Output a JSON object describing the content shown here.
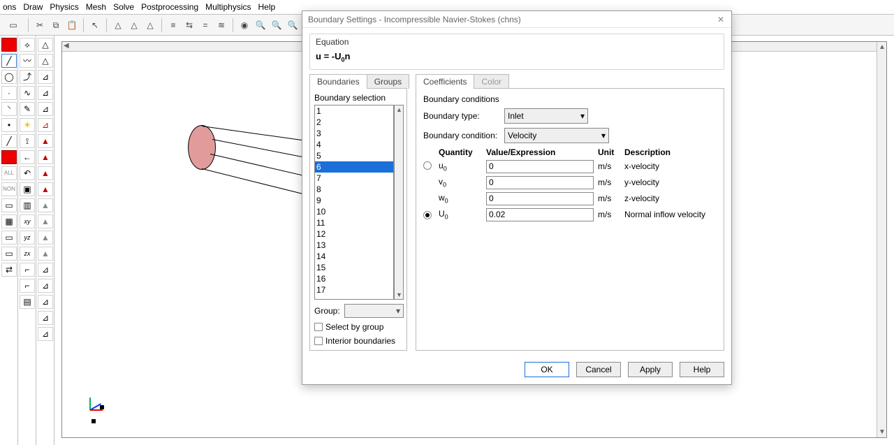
{
  "menu": {
    "items": [
      "ons",
      "Draw",
      "Physics",
      "Mesh",
      "Solve",
      "Postprocessing",
      "Multiphysics",
      "Help"
    ]
  },
  "dialog": {
    "title": "Boundary Settings - Incompressible Navier-Stokes (chns)",
    "equation_label": "Equation",
    "equation_formula_html": "<b>u</b> = -U<sub>0</sub><b>n</b>",
    "tabs_left": {
      "a": "Boundaries",
      "b": "Groups"
    },
    "tabs_right": {
      "a": "Coefficients",
      "b": "Color"
    },
    "boundary_selection_label": "Boundary selection",
    "boundaries": [
      "1",
      "2",
      "3",
      "4",
      "5",
      "6",
      "7",
      "8",
      "9",
      "10",
      "11",
      "12",
      "13",
      "14",
      "15",
      "16",
      "17"
    ],
    "boundary_selected_index": 5,
    "group_label": "Group:",
    "group_value": "",
    "select_by_group": "Select by group",
    "interior_boundaries": "Interior boundaries",
    "bc_header": "Boundary conditions",
    "bt_label": "Boundary type:",
    "bt_value": "Inlet",
    "bcnd_label": "Boundary condition:",
    "bcnd_value": "Velocity",
    "col_qty": "Quantity",
    "col_val": "Value/Expression",
    "col_unit": "Unit",
    "col_desc": "Description",
    "rows": [
      {
        "radio": false,
        "radio_on": false,
        "qty_html": "u<sub>0</sub>",
        "val": "0",
        "unit": "m/s",
        "desc": "x-velocity"
      },
      {
        "radio": null,
        "radio_on": false,
        "qty_html": "v<sub>0</sub>",
        "val": "0",
        "unit": "m/s",
        "desc": "y-velocity"
      },
      {
        "radio": null,
        "radio_on": false,
        "qty_html": "w<sub>0</sub>",
        "val": "0",
        "unit": "m/s",
        "desc": "z-velocity"
      },
      {
        "radio": true,
        "radio_on": true,
        "qty_html": "U<sub>0</sub>",
        "val": "0.02",
        "unit": "m/s",
        "desc": "Normal inflow velocity"
      }
    ],
    "buttons": {
      "ok": "OK",
      "cancel": "Cancel",
      "apply": "Apply",
      "help": "Help"
    }
  }
}
